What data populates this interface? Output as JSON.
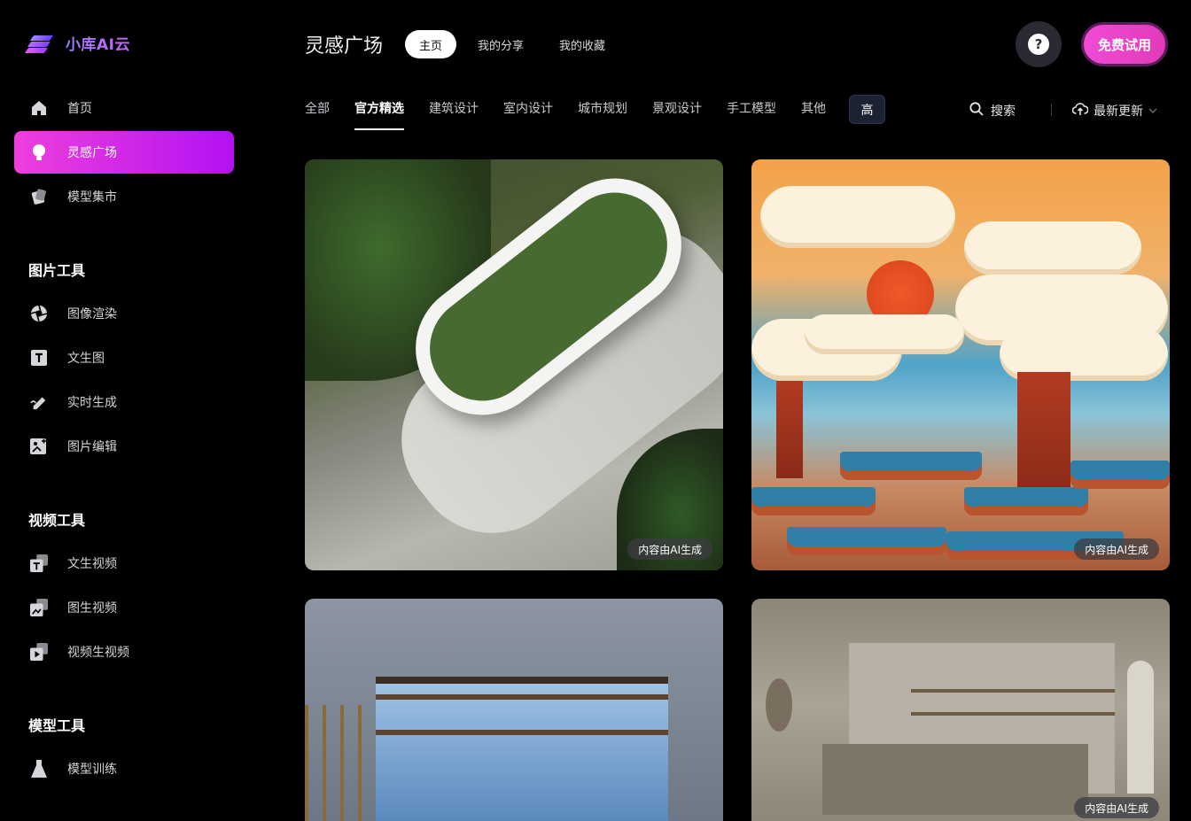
{
  "brand": {
    "name": "小库AI云"
  },
  "sidebar": {
    "main_items": [
      {
        "label": "首页",
        "icon": "home-icon"
      },
      {
        "label": "灵感广场",
        "icon": "lightbulb-icon"
      },
      {
        "label": "模型集市",
        "icon": "model-market-icon"
      }
    ],
    "sections": [
      {
        "title": "图片工具",
        "items": [
          {
            "label": "图像渲染",
            "icon": "aperture-icon"
          },
          {
            "label": "文生图",
            "icon": "text-image-icon"
          },
          {
            "label": "实时生成",
            "icon": "pen-icon"
          },
          {
            "label": "图片编辑",
            "icon": "image-edit-icon"
          }
        ]
      },
      {
        "title": "视频工具",
        "items": [
          {
            "label": "文生视频",
            "icon": "text-video-icon"
          },
          {
            "label": "图生视频",
            "icon": "image-video-icon"
          },
          {
            "label": "视频生视频",
            "icon": "video-video-icon"
          }
        ]
      },
      {
        "title": "模型工具",
        "items": [
          {
            "label": "模型训练",
            "icon": "flask-icon"
          }
        ]
      }
    ]
  },
  "header": {
    "title": "灵感广场",
    "tabs": [
      "主页",
      "我的分享",
      "我的收藏"
    ],
    "help_label": "?",
    "trial_label": "免费试用"
  },
  "filters": {
    "items": [
      "全部",
      "官方精选",
      "建筑设计",
      "室内设计",
      "城市规划",
      "景观设计",
      "手工模型",
      "其他"
    ],
    "active": "官方精选",
    "extra": "高",
    "search_label": "搜索",
    "sort_label": "最新更新"
  },
  "cards": [
    {
      "badge": "内容由AI生成"
    },
    {
      "badge": "内容由AI生成"
    },
    {
      "badge": ""
    },
    {
      "badge": "内容由AI生成"
    }
  ],
  "colors": {
    "accent_start": "#ee3fdc",
    "accent_end": "#b312f2",
    "background": "#000000"
  }
}
